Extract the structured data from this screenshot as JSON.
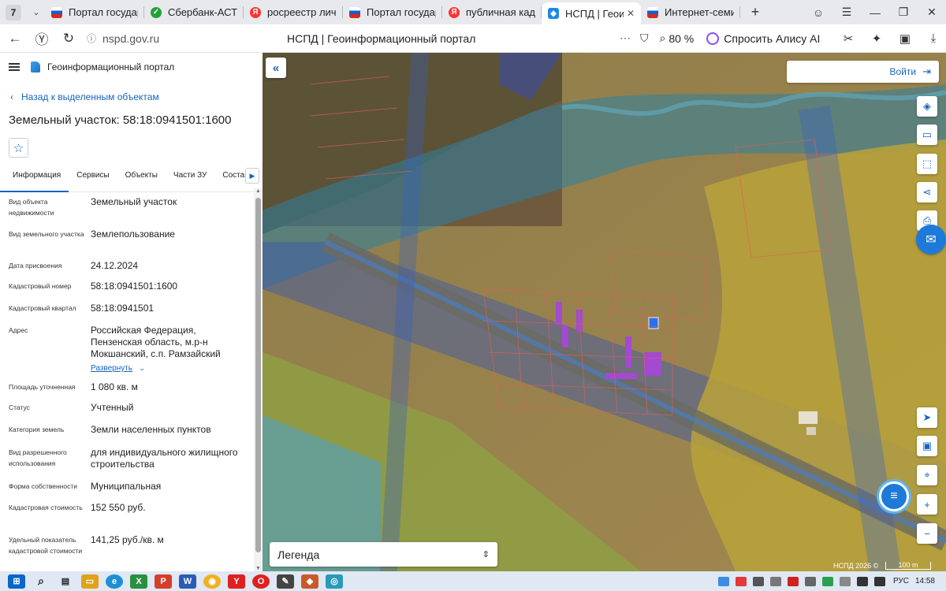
{
  "browser": {
    "tab_count": "7",
    "tabs": [
      {
        "title": "Портал государс",
        "favicon_color": "#d52b1e",
        "active": false
      },
      {
        "title": "Сбербанк-АСТ - З",
        "favicon_color": "#21a038",
        "active": false
      },
      {
        "title": "росреестр личны",
        "favicon_color": "#f33",
        "active": false
      },
      {
        "title": "Портал государс",
        "favicon_color": "#d52b1e",
        "active": false
      },
      {
        "title": "публичная кадас",
        "favicon_color": "#f33",
        "active": false
      },
      {
        "title": "НСПД | Геоинф",
        "favicon_color": "#1e88e5",
        "active": true
      },
      {
        "title": "Интернет-семина",
        "favicon_color": "#b03060",
        "active": false
      }
    ],
    "url": "nspd.gov.ru",
    "page_title": "НСПД | Геоинформационный портал",
    "zoom": "80 %",
    "alice_label": "Спросить Алису AI"
  },
  "panel": {
    "portal_name": "Геоинформационный портал",
    "back_label": "Назад к выделенным объектам",
    "object_title": "Земельный участок: 58:18:0941501:1600",
    "tabs": [
      "Информация",
      "Сервисы",
      "Объекты",
      "Части ЗУ",
      "Состав"
    ],
    "fields": [
      {
        "label": "Вид объекта недвижимости",
        "value": "Земельный участок"
      },
      {
        "label": "Вид земельного участка",
        "value": "Землепользование"
      },
      {
        "label": "Дата присвоения",
        "value": "24.12.2024"
      },
      {
        "label": "Кадастровый номер",
        "value": "58:18:0941501:1600"
      },
      {
        "label": "Кадастровый квартал",
        "value": "58:18:0941501"
      },
      {
        "label": "Адрес",
        "value": "Российская Федерация, Пензенская область, м.р-н Мокшанский, с.п. Рамзайский сельсовет, с. Рамзай,"
      },
      {
        "label": "Площадь уточненная",
        "value": "1 080 кв. м"
      },
      {
        "label": "Статус",
        "value": "Учтенный"
      },
      {
        "label": "Категория земель",
        "value": "Земли населенных пунктов"
      },
      {
        "label": "Вид разрешенного использования",
        "value": "для индивидуального жилищного строительства"
      },
      {
        "label": "Форма собственности",
        "value": "Муниципальная"
      },
      {
        "label": "Кадастровая стоимость",
        "value": "152 550 руб."
      },
      {
        "label": "Удельный показатель кадастровой стоимости",
        "value": "141,25 руб./кв. м"
      }
    ],
    "expand_label": "Развернуть"
  },
  "map": {
    "login_label": "Войти",
    "legend_label": "Легенда",
    "attribution": "НСПД 2026 ©",
    "scale_label": "100 m"
  },
  "taskbar": {
    "language": "РУС",
    "time": "14:58"
  }
}
